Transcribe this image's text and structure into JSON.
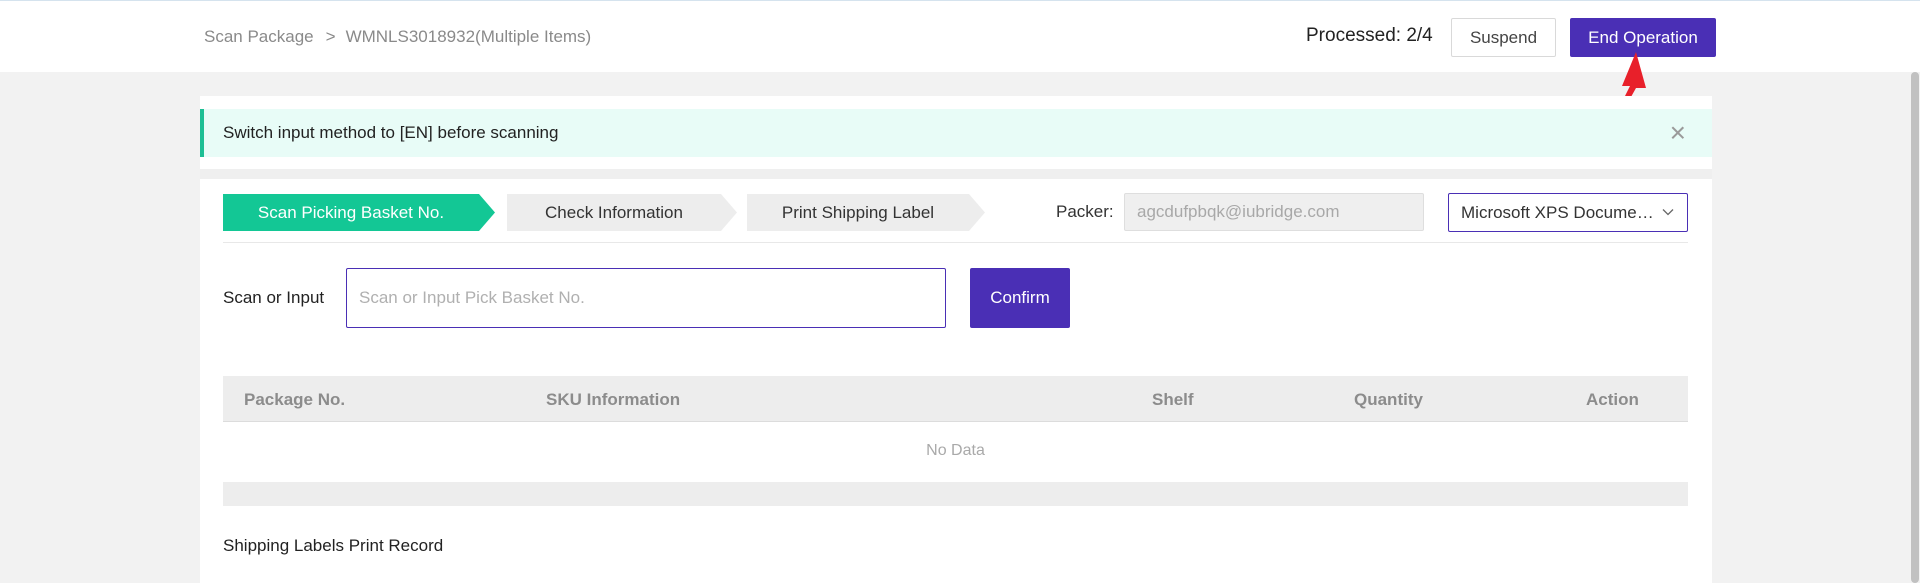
{
  "breadcrumb": {
    "root": "Scan Package",
    "separator": ">",
    "current": "WMNLS3018932(Multiple Items)"
  },
  "header": {
    "processed": "Processed: 2/4",
    "suspend_label": "Suspend",
    "end_label": "End Operation"
  },
  "notice": {
    "text": "Switch input method to [EN] before scanning",
    "close_icon": "×"
  },
  "steps": [
    {
      "label": "Scan Picking Basket No.",
      "active": true
    },
    {
      "label": "Check Information",
      "active": false
    },
    {
      "label": "Print Shipping Label",
      "active": false
    }
  ],
  "packer": {
    "label": "Packer:",
    "value": "agcdufpbqk@iubridge.com"
  },
  "printer": {
    "selected": "Microsoft XPS Document Writer"
  },
  "scan": {
    "label": "Scan or Input",
    "placeholder": "Scan or Input Pick Basket No.",
    "confirm_label": "Confirm"
  },
  "table": {
    "columns": [
      "Package No.",
      "SKU Information",
      "Shelf",
      "Quantity",
      "Action"
    ],
    "rows": [],
    "empty_text": "No Data"
  },
  "print_record": {
    "title": "Shipping Labels Print Record"
  },
  "colors": {
    "primary": "#4a2fb5",
    "step_active": "#13c795",
    "notice_bg": "#e8fcf7",
    "annotation": "#e8202a"
  }
}
